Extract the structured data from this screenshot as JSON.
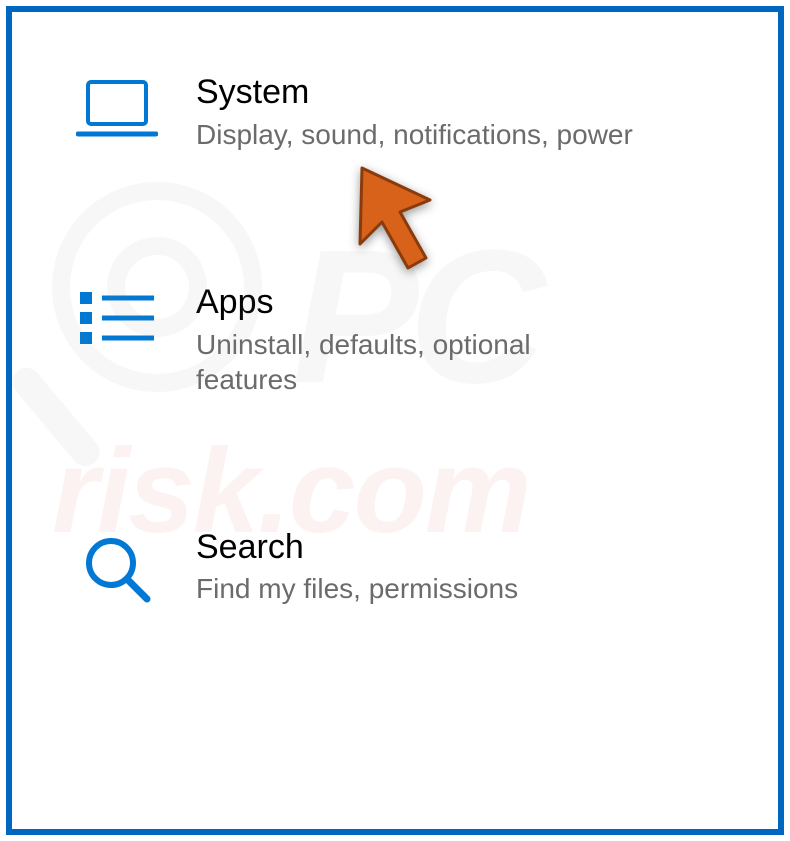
{
  "settings": {
    "items": [
      {
        "key": "system",
        "title": "System",
        "description": "Display, sound, notifications, power",
        "icon": "laptop-icon"
      },
      {
        "key": "apps",
        "title": "Apps",
        "description": "Uninstall, defaults, optional features",
        "icon": "apps-list-icon"
      },
      {
        "key": "search",
        "title": "Search",
        "description": "Find my files, permissions",
        "icon": "search-icon"
      }
    ]
  },
  "watermark": {
    "text_top": "PC",
    "text_bottom": "risk.com"
  },
  "colors": {
    "accent": "#0078D4",
    "frame": "#0067C0",
    "arrow": "#D9621A"
  }
}
